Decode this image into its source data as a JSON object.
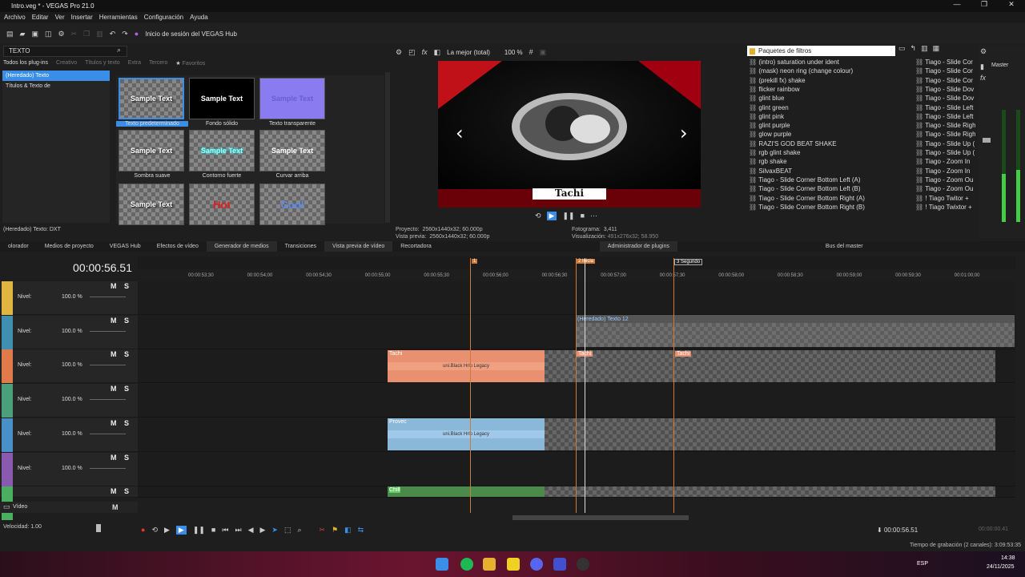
{
  "window": {
    "title": "Intro.veg * - VEGAS Pro 21.0"
  },
  "menu": [
    "Archivo",
    "Editar",
    "Ver",
    "Insertar",
    "Herramientas",
    "Configuración",
    "Ayuda"
  ],
  "toolbar": {
    "hub_label": "Inicio de sesión del VEGAS Hub"
  },
  "generator": {
    "search_value": "TEXTO",
    "tabs": [
      "Todos los plug-ins",
      "Creativo",
      "Títulos y texto",
      "Extra",
      "Tercero",
      "Favoritos"
    ],
    "tree": [
      "(Heredado) Texto",
      "Títulos & Texto de"
    ],
    "presets": [
      {
        "text": "Sample Text",
        "label": "Texto predeterminado"
      },
      {
        "text": "Sample Text",
        "label": "Fondo sólido"
      },
      {
        "text": "Sample Text",
        "label": "Texto transparente"
      },
      {
        "text": "Sample Text",
        "label": "Sombra suave"
      },
      {
        "text": "Sample Text",
        "label": "Contorno fuerte"
      },
      {
        "text": "Sample Text",
        "label": "Curvar arriba"
      },
      {
        "text": "Sample Text",
        "label": ""
      },
      {
        "text": "Hot",
        "label": ""
      },
      {
        "text": "Cool",
        "label": ""
      }
    ],
    "status": "(Heredado) Texto: DXT"
  },
  "preview": {
    "quality": "La mejor (total)",
    "zoom": "100 %",
    "caption": "Tachi",
    "info": {
      "proyecto_label": "Proyecto:",
      "proyecto": "2560x1440x32; 60.000p",
      "vista_label": "Vista previa:",
      "vista": "2560x1440x32; 60.000p",
      "fotograma_label": "Fotograma:",
      "fotograma": "3,411",
      "visualizacion_label": "Visualización:",
      "visualizacion": "491x276x32; 58.950"
    }
  },
  "fx": {
    "header": "Paquetes de filtros",
    "left": [
      "(intro) saturation under ident",
      "(mask) neon ring (change colour)",
      "(prekill fx) shake",
      "flicker rainbow",
      "glint blue",
      "glint green",
      "glint pink",
      "glint purple",
      "glow purple",
      "RAZI'S GOD BEAT SHAKE",
      "rgb glint shake",
      "rgb shake",
      "SilvaxBEAT",
      "Tiago - Slide Corner Bottom Left (A)",
      "Tiago - Slide Corner Bottom Left (B)",
      "Tiago - Slide Corner Bottom Right (A)",
      "Tiago - Slide Corner Bottom Right (B)"
    ],
    "right": [
      "Tiago - Slide Cor",
      "Tiago - Slide Cor",
      "Tiago - Slide Cor",
      "Tiago - Slide Dov",
      "Tiago - Slide Dov",
      "Tiago - Slide Left",
      "Tiago - Slide Left",
      "Tiago - Slide Righ",
      "Tiago - Slide Righ",
      "Tiago - Slide Up (",
      "Tiago - Slide Up (",
      "Tiago - Zoom In",
      "Tiago - Zoom In",
      "Tiago - Zoom Ou",
      "Tiago - Zoom Ou",
      "! Tiago Twitor +",
      "! Tiago Twixtor +"
    ]
  },
  "mixer": {
    "label": "Master"
  },
  "tabs": [
    "olorador",
    "Medios de proyecto",
    "VEGAS Hub",
    "Efectos de vídeo",
    "Generador de medios",
    "Transiciones",
    "Vista previa de vídeo",
    "Recortadora",
    "Administrador de plugins",
    "Bus del master"
  ],
  "timeline": {
    "timecode": "00:00:56.51",
    "ruler": [
      "00:00:53;30",
      "00:00:54;00",
      "00:00:54;30",
      "00:00:55;00",
      "00:00:55;30",
      "00:00:56;00",
      "00:00:56;30",
      "00:00:57;00",
      "00:00:57;30",
      "00:00:58;00",
      "00:00:58;30",
      "00:00:59;00",
      "00:00:59;30",
      "00:01:00;00"
    ],
    "markers": [
      "1",
      "2 Inicia",
      "3 Segundo"
    ],
    "level_label": "Nivel:",
    "tracks": [
      {
        "color": "#e0b640",
        "level": "100.0 %"
      },
      {
        "color": "#3f8fb0",
        "level": "100.0 %"
      },
      {
        "color": "#e07a4a",
        "level": "100.0 %"
      },
      {
        "color": "#4aa07a",
        "level": "100.0 %"
      },
      {
        "color": "#4a90c8",
        "level": "100.0 %"
      },
      {
        "color": "#8a5ab0",
        "level": "100.0 %"
      },
      {
        "color": "#4ab060",
        "level": ""
      }
    ],
    "m_label": "M",
    "s_label": "S",
    "clips": {
      "texto12": "(Heredado) Texto 12",
      "tachi": "Tachi",
      "uni": "uni.Black Hrlo Legacy",
      "provec": "Provec",
      "chill": "Chill"
    },
    "video_label": "Vídeo",
    "speed": "Velocidad: 1.00",
    "bottom_time": "00:00:56.51",
    "bottom_time2": "00:00:00.41"
  },
  "status": {
    "record_time": "Tiempo de grabación (2 canales): 3:09:53:35"
  },
  "taskbar": {
    "lang": "ESP",
    "time": "14:38",
    "date": "24/11/2025"
  }
}
